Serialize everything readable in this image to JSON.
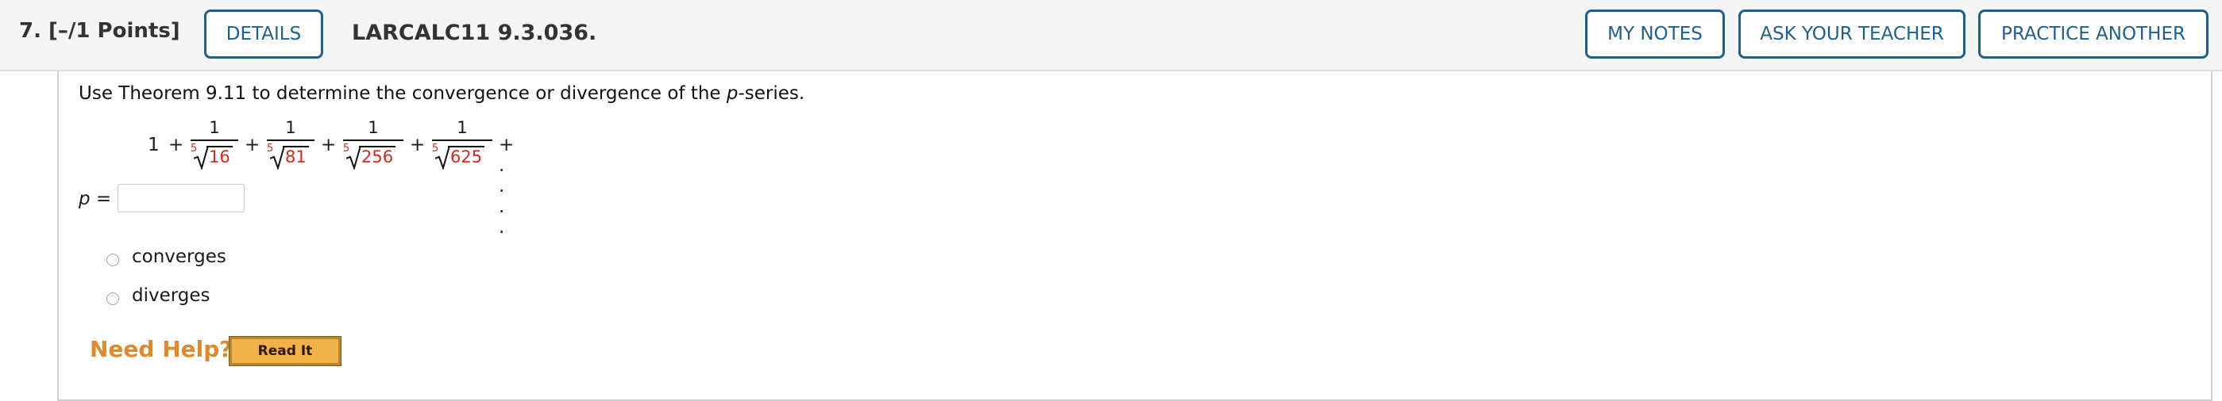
{
  "header": {
    "question_number": "7.",
    "points": "[–/1 Points]",
    "details_label": "DETAILS",
    "question_ref": "LARCALC11 9.3.036.",
    "my_notes_label": "MY NOTES",
    "ask_teacher_label": "ASK YOUR TEACHER",
    "practice_label": "PRACTICE ANOTHER"
  },
  "problem": {
    "prompt_start": "Use Theorem 9.11 to determine the convergence or divergence of the ",
    "prompt_var": "p",
    "prompt_end": "-series.",
    "series": {
      "first_term": "1",
      "plus": "+",
      "numerator": "1",
      "root_index": "5",
      "radicands": [
        "16",
        "81",
        "256",
        "625"
      ],
      "tail": "+ . . . ."
    },
    "p_label_var": "p",
    "p_label_eq": " =",
    "p_value": ""
  },
  "choices": [
    {
      "label": "converges"
    },
    {
      "label": "diverges"
    }
  ],
  "help": {
    "need_help": "Need Help?",
    "read_it": "Read It"
  },
  "colors": {
    "accent": "#1f5f8b",
    "radicand": "#d22a1e",
    "help_orange": "#e0892a",
    "button_gold": "#f2b24a"
  }
}
